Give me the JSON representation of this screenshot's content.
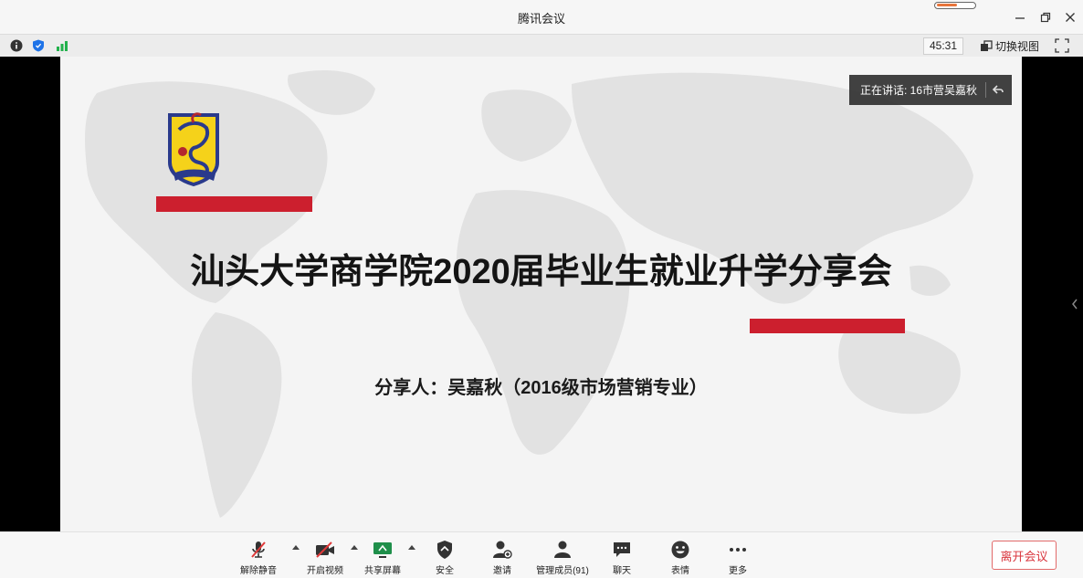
{
  "window": {
    "title": "腾讯会议",
    "controls": [
      "minimize-icon",
      "restore-icon",
      "close-icon"
    ]
  },
  "infobar": {
    "timer": "45:31",
    "switch_view_label": "切换视图",
    "icons": [
      "info-icon",
      "shield-icon",
      "signal-icon",
      "fullscreen-icon"
    ]
  },
  "slide": {
    "title": "汕头大学商学院2020届毕业生就业升学分享会",
    "subtitle": "分享人：吴嘉秋（2016级市场营销专业）",
    "accent_color": "#cc1f2e"
  },
  "speaker": {
    "label": "正在讲话: 16市营吴嘉秋"
  },
  "toolbar": {
    "items": [
      {
        "label": "解除静音",
        "icon": "microphone-muted-icon"
      },
      {
        "label": "开启视频",
        "icon": "camera-off-icon"
      },
      {
        "label": "共享屏幕",
        "icon": "share-screen-icon"
      },
      {
        "label": "安全",
        "icon": "security-icon"
      },
      {
        "label": "邀请",
        "icon": "invite-icon"
      },
      {
        "label": "管理成员(91)",
        "icon": "members-icon"
      },
      {
        "label": "聊天",
        "icon": "chat-icon"
      },
      {
        "label": "表情",
        "icon": "emoji-icon"
      },
      {
        "label": "更多",
        "icon": "more-icon"
      }
    ],
    "leave_label": "离开会议",
    "leave_color": "#d9363e"
  }
}
